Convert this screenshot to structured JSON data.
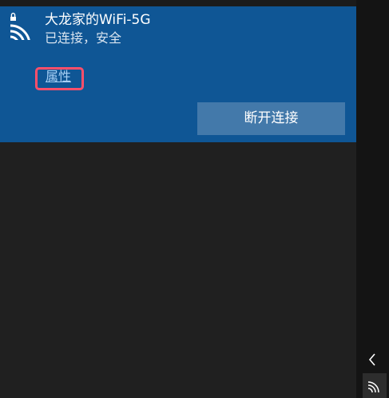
{
  "network": {
    "name": "大龙家的WiFi-5G",
    "status": "已连接，安全",
    "properties_label": "属性",
    "disconnect_label": "断开连接"
  },
  "icons": {
    "network_icon": "secured-wifi-icon",
    "tray_expand_icon": "chevron-left-icon",
    "tray_network_icon": "wifi-icon"
  },
  "colors": {
    "card_background": "#0f5695",
    "panel_background": "#202020",
    "button_background": "#4379aa",
    "link_color": "#a8d0f5",
    "highlight_border": "#ff4f6a"
  }
}
